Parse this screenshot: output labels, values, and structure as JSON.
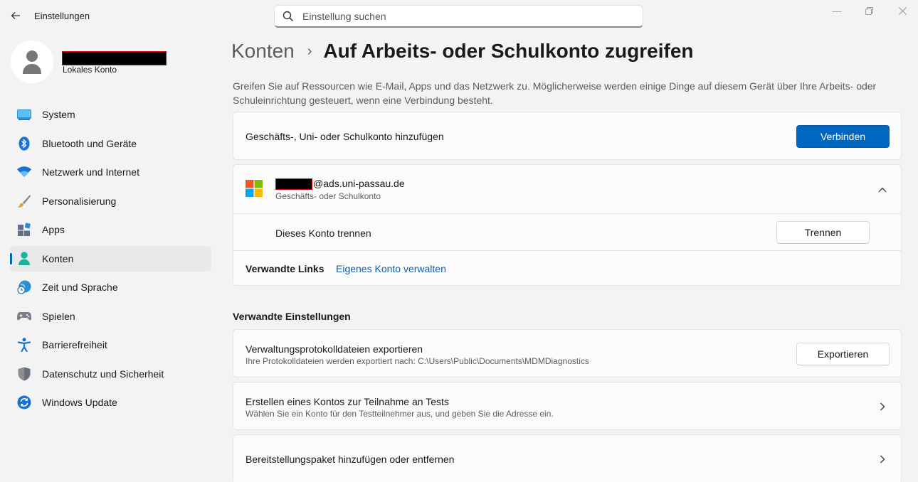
{
  "titlebar": {
    "app_title": "Einstellungen",
    "search_placeholder": "Einstellung suchen"
  },
  "profile": {
    "account_type": "Lokales Konto"
  },
  "sidebar": {
    "items": [
      {
        "label": "System",
        "icon": "system-icon"
      },
      {
        "label": "Bluetooth und Geräte",
        "icon": "bluetooth-icon"
      },
      {
        "label": "Netzwerk und Internet",
        "icon": "wifi-icon"
      },
      {
        "label": "Personalisierung",
        "icon": "brush-icon"
      },
      {
        "label": "Apps",
        "icon": "apps-icon"
      },
      {
        "label": "Konten",
        "icon": "person-icon",
        "active": true
      },
      {
        "label": "Zeit und Sprache",
        "icon": "globe-clock-icon"
      },
      {
        "label": "Spielen",
        "icon": "gamepad-icon"
      },
      {
        "label": "Barrierefreiheit",
        "icon": "accessibility-icon"
      },
      {
        "label": "Datenschutz und Sicherheit",
        "icon": "shield-icon"
      },
      {
        "label": "Windows Update",
        "icon": "update-icon"
      }
    ]
  },
  "breadcrumb": {
    "parent": "Konten",
    "separator": "›",
    "current": "Auf Arbeits- oder Schulkonto zugreifen"
  },
  "intro": "Greifen Sie auf Ressourcen wie E-Mail, Apps und das Netzwerk zu. Möglicherweise werden einige Dinge auf diesem Gerät über Ihre Arbeits- oder Schuleinrichtung gesteuert, wenn eine Verbindung besteht.",
  "add_account": {
    "label": "Geschäfts-, Uni- oder Schulkonto hinzufügen",
    "button": "Verbinden"
  },
  "account": {
    "email_suffix": "@ads.uni-passau.de",
    "type": "Geschäfts- oder Schulkonto",
    "disconnect_label": "Dieses Konto trennen",
    "disconnect_button": "Trennen",
    "related_links_label": "Verwandte Links",
    "manage_link": "Eigenes Konto verwalten"
  },
  "related_settings": {
    "heading": "Verwandte Einstellungen",
    "export": {
      "title": "Verwaltungsprotokolldateien exportieren",
      "subtitle": "Ihre Protokolldateien werden exportiert nach: C:\\Users\\Public\\Documents\\MDMDiagnostics",
      "button": "Exportieren"
    },
    "test_account": {
      "title": "Erstellen eines Kontos zur Teilnahme an Tests",
      "subtitle": "Wählen Sie ein Konto für den Testteilnehmer aus, und geben Sie die Adresse ein."
    },
    "provisioning": {
      "title": "Bereitstellungspaket hinzufügen oder entfernen"
    }
  },
  "colors": {
    "accent": "#0067c0",
    "background": "#f3f3f3",
    "card": "#fbfbfb",
    "link": "#0f5fa8"
  }
}
